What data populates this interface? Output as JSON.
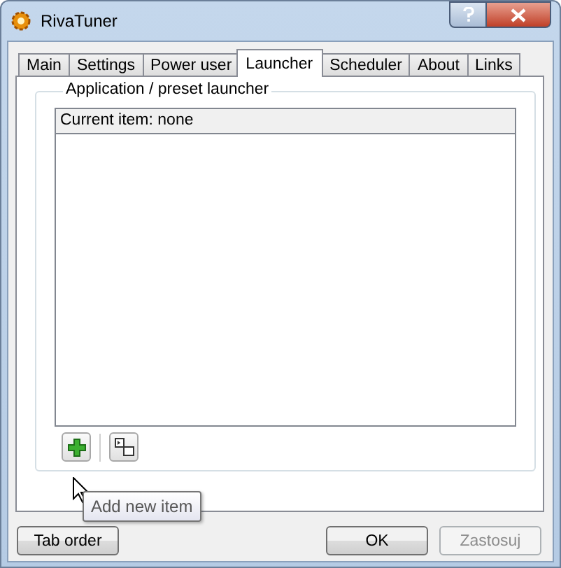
{
  "window": {
    "title": "RivaTuner"
  },
  "tabs": [
    {
      "label": "Main",
      "selected": false
    },
    {
      "label": "Settings",
      "selected": false
    },
    {
      "label": "Power user",
      "selected": false
    },
    {
      "label": "Launcher",
      "selected": true
    },
    {
      "label": "Scheduler",
      "selected": false
    },
    {
      "label": "About",
      "selected": false
    },
    {
      "label": "Links",
      "selected": false
    }
  ],
  "group": {
    "title": "Application / preset launcher",
    "list_header": "Current item: none"
  },
  "tooltip": "Add new item",
  "buttons": [
    {
      "label": "Tab order",
      "disabled": false
    },
    {
      "label": "OK",
      "disabled": false
    },
    {
      "label": "Zastosuj",
      "disabled": true
    }
  ]
}
